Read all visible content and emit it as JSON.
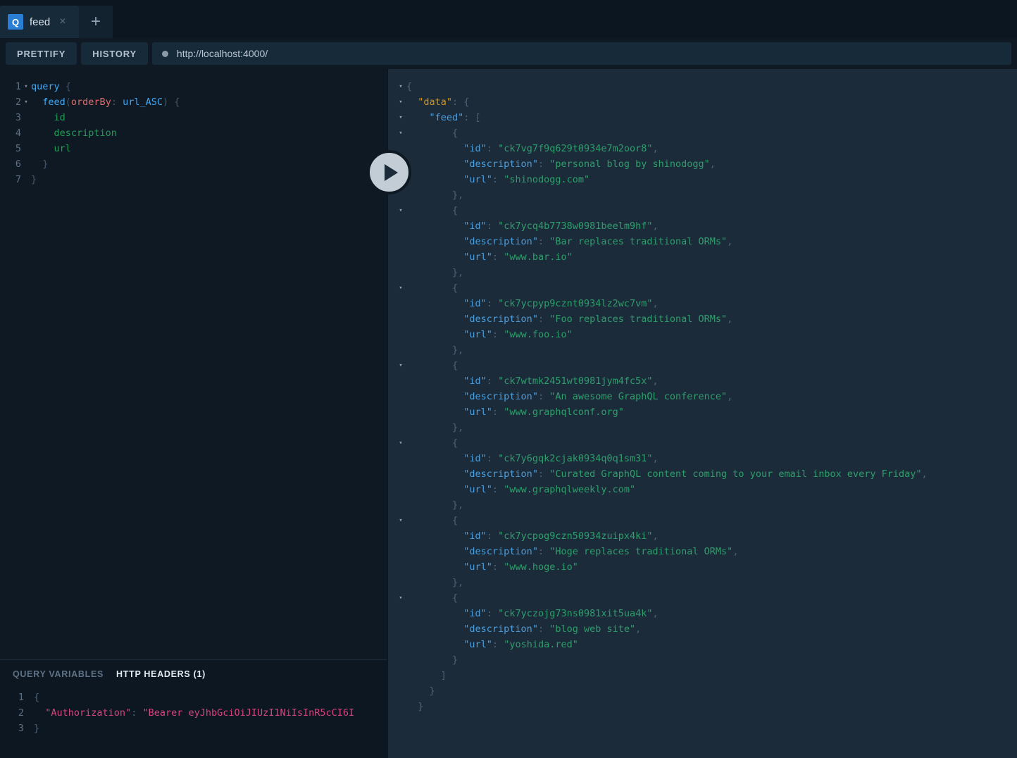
{
  "tab": {
    "badge": "Q",
    "label": "feed",
    "close": "×",
    "add": "+"
  },
  "toolbar": {
    "prettify": "PRETTIFY",
    "history": "HISTORY",
    "endpoint": "http://localhost:4000/"
  },
  "execute": {
    "label": "execute-query"
  },
  "query_editor": {
    "lines": [
      {
        "n": "1",
        "fold": "▾"
      },
      {
        "n": "2",
        "fold": "▾"
      },
      {
        "n": "3",
        "fold": ""
      },
      {
        "n": "4",
        "fold": ""
      },
      {
        "n": "5",
        "fold": ""
      },
      {
        "n": "6",
        "fold": ""
      },
      {
        "n": "7",
        "fold": ""
      }
    ],
    "tokens": {
      "query_kw": "query",
      "open_brace": " {",
      "feed_fn": "feed",
      "paren_open": "(",
      "arg_name": "orderBy",
      "colon": ": ",
      "arg_value": "url_ASC",
      "paren_close": ")",
      "brace2": " {",
      "field_id": "id",
      "field_description": "description",
      "field_url": "url",
      "close_inner": "}",
      "close_outer": "}"
    }
  },
  "variables_panel": {
    "tab_query_variables": "QUERY VARIABLES",
    "tab_http_headers": "HTTP HEADERS (1)",
    "lines": [
      "1",
      "2",
      "3"
    ],
    "open_brace": "{",
    "header_key": "\"Authorization\"",
    "header_colon": ": ",
    "header_value": "\"Bearer eyJhbGciOiJIUzI1NiIsInR5cCI6I",
    "close_brace": "}"
  },
  "response": {
    "data_key": "\"data\"",
    "feed_key": "\"feed\"",
    "key_id": "\"id\"",
    "key_description": "\"description\"",
    "key_url": "\"url\"",
    "items": [
      {
        "id": "\"ck7vg7f9q629t0934e7m2oor8\"",
        "description": "\"personal blog by shinodogg\"",
        "url": "\"shinodogg.com\""
      },
      {
        "id": "\"ck7ycq4b7738w0981beelm9hf\"",
        "description": "\"Bar replaces traditional ORMs\"",
        "url": "\"www.bar.io\""
      },
      {
        "id": "\"ck7ycpyp9cznt0934lz2wc7vm\"",
        "description": "\"Foo replaces traditional ORMs\"",
        "url": "\"www.foo.io\""
      },
      {
        "id": "\"ck7wtmk2451wt0981jym4fc5x\"",
        "description": "\"An awesome GraphQL conference\"",
        "url": "\"www.graphqlconf.org\""
      },
      {
        "id": "\"ck7y6gqk2cjak0934q0q1sm31\"",
        "description": "\"Curated GraphQL content coming to your email inbox every Friday\"",
        "url": "\"www.graphqlweekly.com\""
      },
      {
        "id": "\"ck7ycpog9czn50934zuipx4ki\"",
        "description": "\"Hoge replaces traditional ORMs\"",
        "url": "\"www.hoge.io\""
      },
      {
        "id": "\"ck7yczojg73ns0981xit5ua4k\"",
        "description": "\"blog web site\"",
        "url": "\"yoshida.red\""
      }
    ]
  },
  "colors": {
    "accent_blue": "#2a7fd4",
    "editor_bg": "#0f1924",
    "response_bg": "#1b2b3a",
    "string_green": "#2e9e6b",
    "key_blue": "#4a9fe0",
    "data_orange": "#d4941e",
    "header_pink": "#d9447e"
  }
}
